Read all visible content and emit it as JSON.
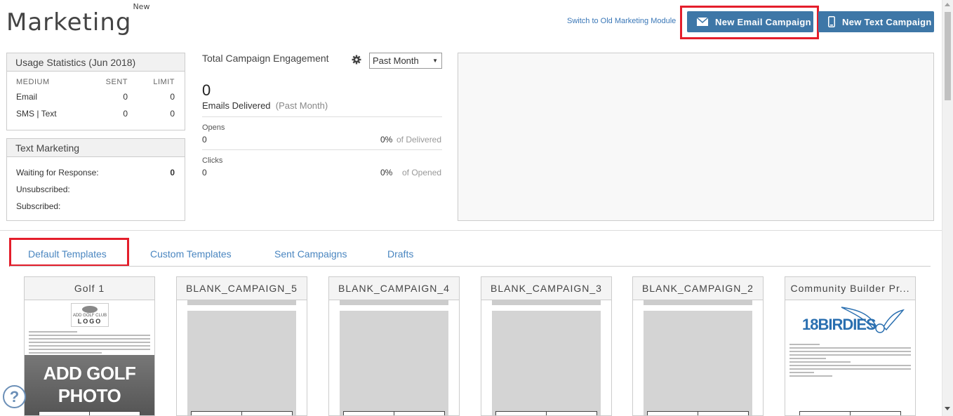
{
  "header": {
    "title": "Marketing",
    "title_badge": "New",
    "switch_link": "Switch to Old Marketing Module",
    "new_email_button": "New Email Campaign",
    "new_text_button": "New Text Campaign"
  },
  "usage": {
    "title": "Usage Statistics (Jun 2018)",
    "columns": [
      "MEDIUM",
      "SENT",
      "LIMIT"
    ],
    "rows": [
      {
        "medium": "Email",
        "sent": "0",
        "limit": "0"
      },
      {
        "medium": "SMS | Text",
        "sent": "0",
        "limit": "0"
      }
    ]
  },
  "text_marketing": {
    "title": "Text Marketing",
    "waiting_label": "Waiting for Response:",
    "waiting_value": "0",
    "unsubscribed_label": "Unsubscribed:",
    "subscribed_label": "Subscribed:"
  },
  "engagement": {
    "title": "Total Campaign Engagement",
    "period": "Past Month",
    "delivered_count": "0",
    "delivered_label": "Emails Delivered",
    "delivered_period": "(Past Month)",
    "opens_label": "Opens",
    "opens_value": "0",
    "opens_pct": "0%",
    "opens_of": "of Delivered",
    "clicks_label": "Clicks",
    "clicks_value": "0",
    "clicks_pct": "0%",
    "clicks_of": "of Opened"
  },
  "tabs": [
    {
      "label": "Default Templates"
    },
    {
      "label": "Custom Templates"
    },
    {
      "label": "Sent Campaigns"
    },
    {
      "label": "Drafts"
    }
  ],
  "templates": [
    {
      "name": "Golf 1",
      "logo_line1": "ADD GOLF CLUB",
      "logo_line2": "LOGO",
      "photo_text": "ADD GOLF PHOTO"
    },
    {
      "name": "BLANK_CAMPAIGN_5"
    },
    {
      "name": "BLANK_CAMPAIGN_4"
    },
    {
      "name": "BLANK_CAMPAIGN_3"
    },
    {
      "name": "BLANK_CAMPAIGN_2"
    },
    {
      "name": "Community Builder Pr...",
      "logo_text": "18BIRDIES"
    }
  ],
  "help": "?",
  "colors": {
    "accent": "#3e77a7",
    "highlight": "#e41e2b",
    "link": "#4a86c0"
  }
}
